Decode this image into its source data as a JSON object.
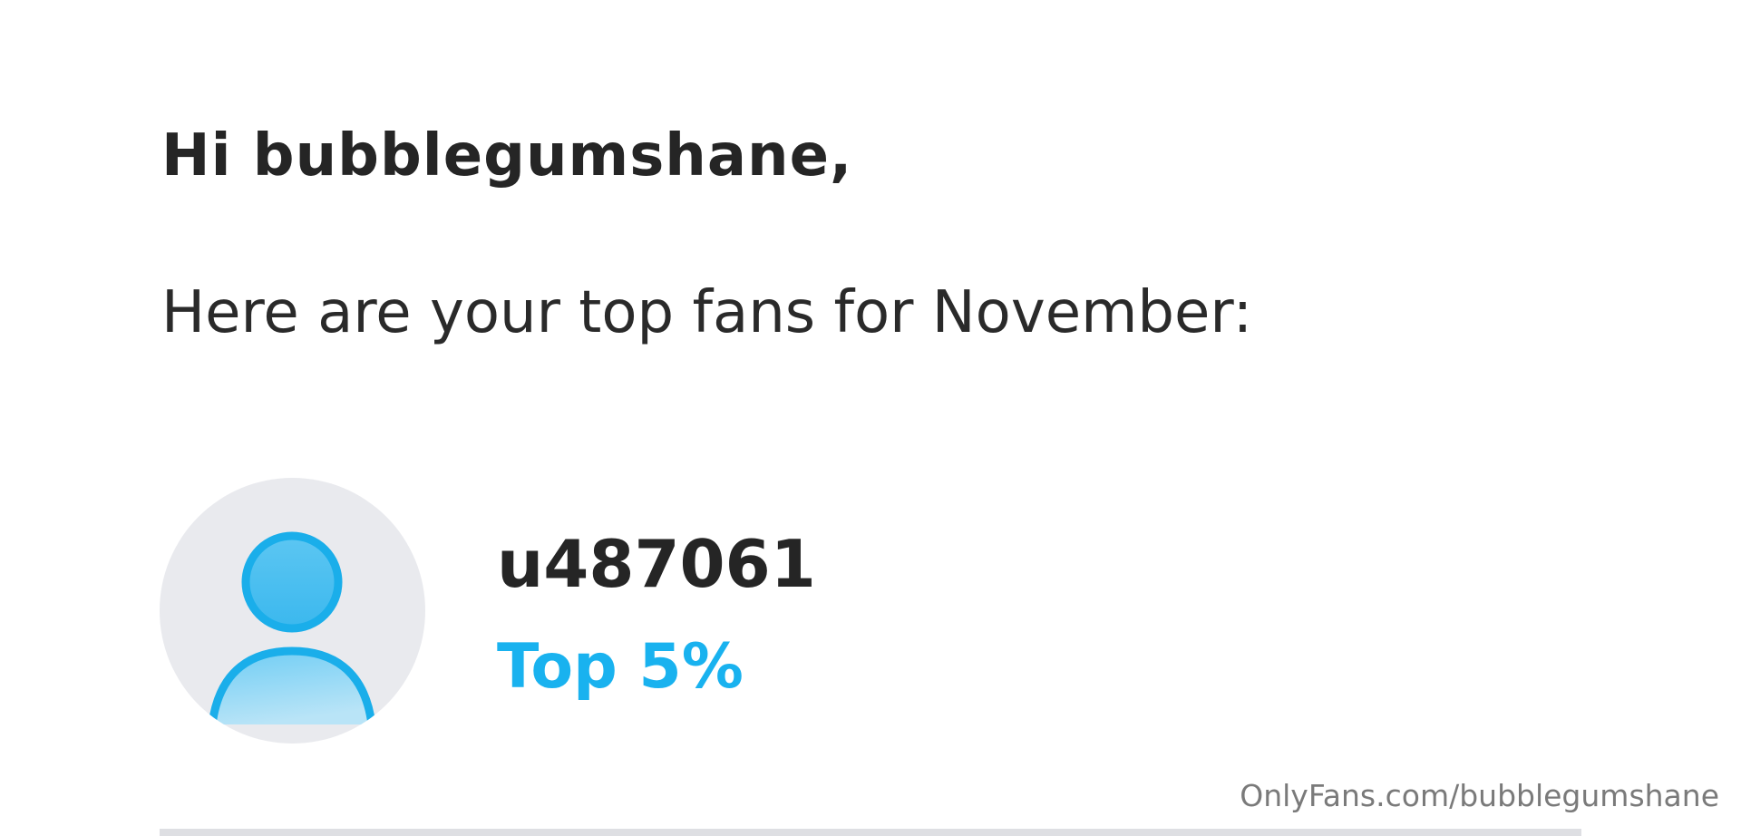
{
  "greeting": "Hi bubblegumshane,",
  "intro": "Here are your top fans for November:",
  "fans": [
    {
      "username": "u487061",
      "rank_label": "Top 5%",
      "avatar_icon": "default-user-avatar-icon"
    }
  ],
  "watermark": "OnlyFans.com/bubblegumshane",
  "colors": {
    "accent": "#19b2ef",
    "avatar_background": "#e9eaee",
    "text": "#252525"
  }
}
